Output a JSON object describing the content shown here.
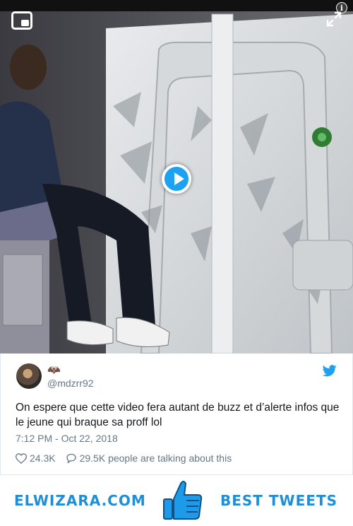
{
  "tweet": {
    "display_name": "🦇",
    "handle": "@mdzrr92",
    "text": "On espere que cette video fera autant de buzz et d’alerte infos que le jeune qui braque sa proff lol",
    "timestamp": "7:12 PM - Oct 22, 2018",
    "likes": "24.3K",
    "replies": "29.5K people are talking about this"
  },
  "video": {
    "info_label": "i"
  },
  "footer": {
    "site": "ELWIZARA.COM",
    "tagline": "BEST TWEETS"
  },
  "colors": {
    "twitter_blue": "#1da1f2",
    "brand_blue": "#1e8fd6",
    "muted_text": "#657786"
  }
}
